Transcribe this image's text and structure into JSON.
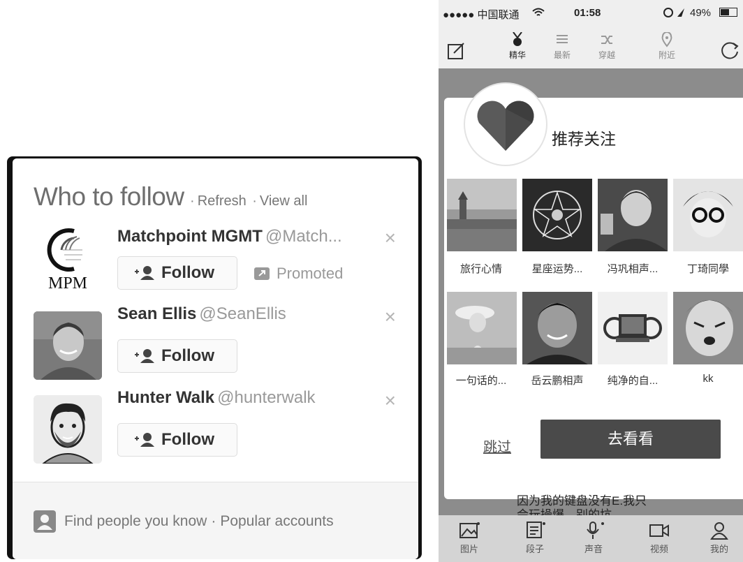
{
  "left_panel": {
    "title": "Who to follow",
    "separator": "·",
    "refresh_label": "Refresh",
    "view_all_label": "View all",
    "suggestions": [
      {
        "name": "Matchpoint MGMT",
        "handle": "@Match...",
        "follow_label": "Follow",
        "promoted_label": "Promoted",
        "avatar_text": "MPM",
        "dismiss": "×"
      },
      {
        "name": "Sean Ellis",
        "handle": "@SeanEllis",
        "follow_label": "Follow",
        "dismiss": "×"
      },
      {
        "name": "Hunter Walk",
        "handle": "@hunterwalk",
        "follow_label": "Follow",
        "dismiss": "×"
      }
    ],
    "footer": {
      "find_people_label": "Find people you know",
      "separator": "·",
      "popular_label": "Popular accounts"
    }
  },
  "right_panel": {
    "status_bar": {
      "carrier": "●●●●● 中国联通",
      "time": "01:58",
      "battery": "49%"
    },
    "top_nav": [
      {
        "label": "精华",
        "icon": "medal-icon",
        "active": true
      },
      {
        "label": "最新",
        "icon": "list-icon",
        "active": false
      },
      {
        "label": "穿越",
        "icon": "shuffle-icon",
        "active": false
      },
      {
        "label": "附近",
        "icon": "location-icon",
        "active": false
      }
    ],
    "modal": {
      "title": "推荐关注",
      "accounts": [
        {
          "label": "旅行心情"
        },
        {
          "label": "星座运势..."
        },
        {
          "label": "冯巩相声..."
        },
        {
          "label": "丁琦同學"
        },
        {
          "label": "一句话的..."
        },
        {
          "label": "岳云鹏相声"
        },
        {
          "label": "纯净的自..."
        },
        {
          "label": "kk"
        }
      ],
      "skip_label": "跳过",
      "go_label": "去看看"
    },
    "behind_text": [
      "因为我的键盘没有E.我只",
      "会玩操爆。别的坑"
    ],
    "tab_bar": [
      {
        "label": "图片",
        "icon": "image-icon"
      },
      {
        "label": "段子",
        "icon": "text-icon"
      },
      {
        "label": "声音",
        "icon": "mic-icon"
      },
      {
        "label": "视频",
        "icon": "video-icon"
      },
      {
        "label": "我的",
        "icon": "user-icon"
      }
    ],
    "colors": {
      "overlay_gray": "#8c8c8c",
      "primary_button": "#4a4a4a",
      "heart": "#555555"
    }
  }
}
